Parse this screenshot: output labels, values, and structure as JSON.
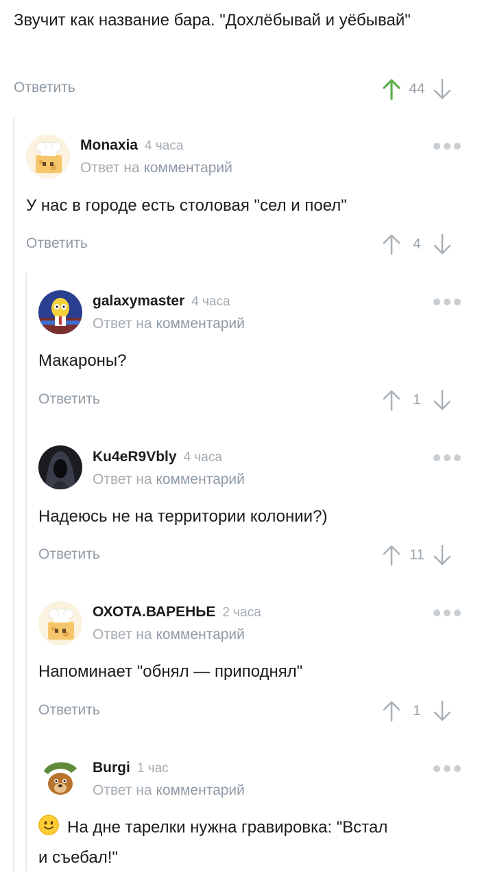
{
  "top": {
    "text": "Звучит как название бара. \"Дохлёбывай и уёбывай\"",
    "reply_label": "Ответить",
    "rating": "44",
    "upvoted": true
  },
  "colors": {
    "upvote_active": "#5bb04a",
    "arrow_inactive": "#a9b1b8",
    "thread_line": "#e6e8ea"
  },
  "comments": [
    {
      "author": "Monaxia",
      "time": "4 часа",
      "reply_prefix": "Ответ на",
      "reply_link": "комментарий",
      "text": "У нас в городе есть столовая \"сел и поел\"",
      "reply_label": "Ответить",
      "rating": "4",
      "avatar": "chef-cheese-avatar"
    },
    {
      "author": "galaxymaster",
      "time": "4 часа",
      "reply_prefix": "Ответ на",
      "reply_link": "комментарий",
      "text": "Макароны?",
      "reply_label": "Ответить",
      "rating": "1",
      "avatar": "cartoon-character-avatar"
    },
    {
      "author": "Ku4eR9Vbly",
      "time": "4 часа",
      "reply_prefix": "Ответ на",
      "reply_link": "комментарий",
      "text": "Надеюсь не на территории колонии?)",
      "reply_label": "Ответить",
      "rating": "11",
      "avatar": "hooded-figure-avatar"
    },
    {
      "author": "ОХОТА.ВАРЕНЬЕ",
      "time": "2 часа",
      "reply_prefix": "Ответ на",
      "reply_link": "комментарий",
      "text": "Напоминает \"обнял — приподнял\"",
      "reply_label": "Ответить",
      "rating": "1",
      "avatar": "chef-cheese-avatar"
    },
    {
      "author": "Burgi",
      "time": "1 час",
      "reply_prefix": "Ответ на",
      "reply_link": "комментарий",
      "text": "На дне тарелки нужна гравировка: \"Встал и съебал!\"",
      "emoji": "slightly-smiling-face-icon",
      "avatar": "bear-with-hat-avatar"
    }
  ]
}
